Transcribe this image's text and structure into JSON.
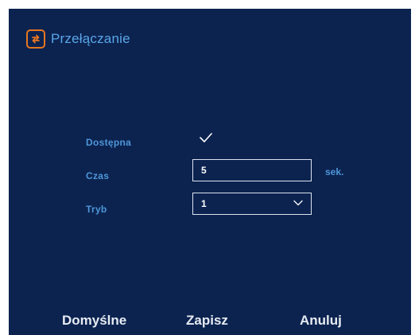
{
  "header": {
    "title": "Przełączanie",
    "icon": "switch-arrows-icon",
    "icon_color": "#e8761f"
  },
  "form": {
    "available": {
      "label": "Dostępna",
      "checked": true
    },
    "time": {
      "label": "Czas",
      "value": "5",
      "unit": "sek."
    },
    "mode": {
      "label": "Tryb",
      "value": "1"
    }
  },
  "footer": {
    "default_label": "Domyślne",
    "save_label": "Zapisz",
    "cancel_label": "Anuluj"
  },
  "colors": {
    "background": "#0c2350",
    "label": "#4e96d8",
    "title": "#5aa6e8",
    "accent": "#e8761f"
  }
}
